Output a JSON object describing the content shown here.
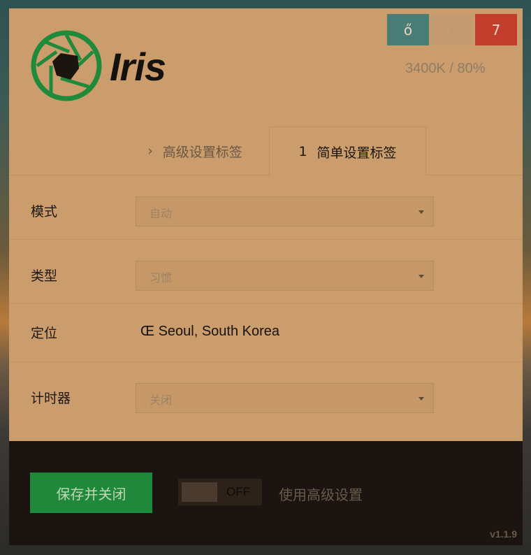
{
  "window_buttons": {
    "btn1": "ő",
    "btn2": "ː",
    "btn3": "7"
  },
  "app": {
    "name": "Iris",
    "status": "3400K / 80%",
    "version": "v1.1.9"
  },
  "tabs": [
    {
      "glyph": "›",
      "label": "高级设置标签"
    },
    {
      "glyph": "1",
      "label": "简单设置标签"
    }
  ],
  "settings": {
    "mode": {
      "label": "模式",
      "value": "自动"
    },
    "type": {
      "label": "类型",
      "value": "习惯"
    },
    "location": {
      "label": "定位",
      "icon": "Œ",
      "value": "Seoul, South Korea"
    },
    "timer": {
      "label": "计时器",
      "value": "关闭"
    }
  },
  "footer": {
    "save_label": "保存并关闭",
    "toggle_state": "OFF",
    "toggle_label": "使用高级设置"
  },
  "colors": {
    "window_bg": "#cb9c6c",
    "footer_bg": "#1b1410",
    "save_green": "#1f883a",
    "logo_green": "#1f8a3a",
    "close_red": "#c23d2c"
  }
}
